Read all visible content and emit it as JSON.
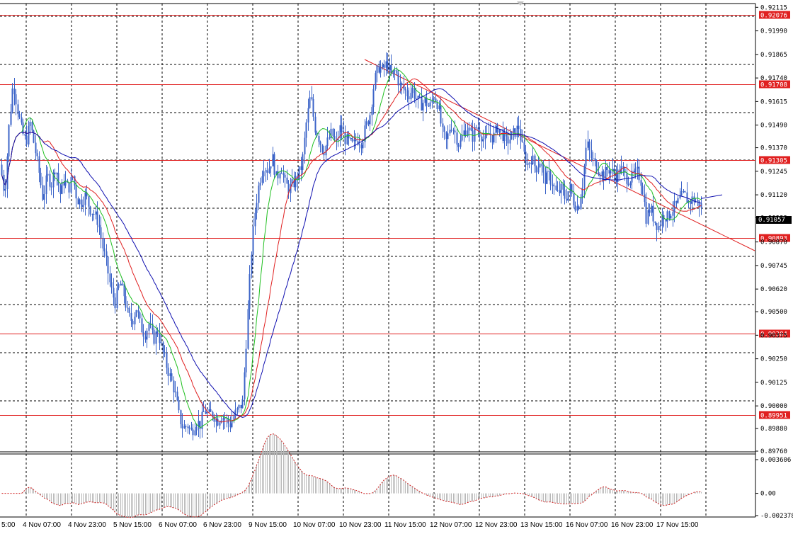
{
  "colors": {
    "background": "#ffffff",
    "grid": "#000000",
    "candles": "#3c64c8",
    "level_lines": "#e02020",
    "trendline": "#e02020",
    "ma_fast": "#20c020",
    "ma_mid": "#e02020",
    "ma_slow": "#1010b0",
    "current_price_tag": "#000000",
    "macd_histogram": "#b8b8b8",
    "macd_signal": "#d02020"
  },
  "chart_data": {
    "type": "candlestick",
    "price_axis_ticks": [
      "0.92115",
      "0.91990",
      "0.91865",
      "0.91740",
      "0.91615",
      "0.91490",
      "0.91370",
      "0.91245",
      "0.91120",
      "0.90999",
      "0.90870",
      "0.90745",
      "0.90620",
      "0.90500",
      "0.90375",
      "0.90250",
      "0.90125",
      "0.90000",
      "0.89880",
      "0.89760"
    ],
    "time_axis_ticks": [
      "5:00",
      "4 Nov 07:00",
      "4 Nov 23:00",
      "5 Nov 15:00",
      "6 Nov 07:00",
      "6 Nov 23:00",
      "9 Nov 15:00",
      "10 Nov 07:00",
      "10 Nov 23:00",
      "11 Nov 15:00",
      "12 Nov 07:00",
      "12 Nov 23:00",
      "13 Nov 15:00",
      "16 Nov 07:00",
      "16 Nov 23:00",
      "17 Nov 15:00"
    ],
    "levels": [
      "0.92076",
      "0.91708",
      "0.91305",
      "0.90893",
      "0.90384",
      "0.89951"
    ],
    "current_price": "0.91057",
    "ylim": [
      0.8976,
      0.92135
    ],
    "close_path": [
      [
        0,
        0.9128
      ],
      [
        6,
        0.9112
      ],
      [
        12,
        0.9148
      ],
      [
        18,
        0.9172
      ],
      [
        24,
        0.9158
      ],
      [
        30,
        0.9146
      ],
      [
        36,
        0.914
      ],
      [
        42,
        0.915
      ],
      [
        48,
        0.9138
      ],
      [
        54,
        0.9125
      ],
      [
        60,
        0.911
      ],
      [
        66,
        0.9122
      ],
      [
        72,
        0.9118
      ],
      [
        78,
        0.9128
      ],
      [
        84,
        0.9112
      ],
      [
        90,
        0.912
      ],
      [
        96,
        0.9115
      ],
      [
        102,
        0.9122
      ],
      [
        108,
        0.911
      ],
      [
        114,
        0.9108
      ],
      [
        120,
        0.9112
      ],
      [
        126,
        0.9105
      ],
      [
        132,
        0.9102
      ],
      [
        138,
        0.9098
      ],
      [
        144,
        0.9085
      ],
      [
        150,
        0.9075
      ],
      [
        156,
        0.9062
      ],
      [
        162,
        0.9055
      ],
      [
        168,
        0.9065
      ],
      [
        174,
        0.906
      ],
      [
        180,
        0.9048
      ],
      [
        186,
        0.9045
      ],
      [
        192,
        0.9052
      ],
      [
        198,
        0.9042
      ],
      [
        204,
        0.9038
      ],
      [
        210,
        0.9044
      ],
      [
        216,
        0.9035
      ],
      [
        222,
        0.904
      ],
      [
        228,
        0.903
      ],
      [
        234,
        0.9022
      ],
      [
        240,
        0.9015
      ],
      [
        246,
        0.9008
      ],
      [
        252,
        0.8995
      ],
      [
        258,
        0.8988
      ],
      [
        264,
        0.899
      ],
      [
        270,
        0.8986
      ],
      [
        276,
        0.8992
      ],
      [
        282,
        0.899
      ],
      [
        288,
        0.8998
      ],
      [
        294,
        0.8995
      ],
      [
        300,
        0.8996
      ],
      [
        306,
        0.8992
      ],
      [
        312,
        0.8995
      ],
      [
        318,
        0.8993
      ],
      [
        324,
        0.899
      ],
      [
        330,
        0.8995
      ],
      [
        336,
        0.8998
      ],
      [
        342,
        0.9002
      ],
      [
        348,
        0.904
      ],
      [
        354,
        0.908
      ],
      [
        360,
        0.9105
      ],
      [
        366,
        0.912
      ],
      [
        372,
        0.9128
      ],
      [
        378,
        0.9125
      ],
      [
        384,
        0.9132
      ],
      [
        390,
        0.912
      ],
      [
        396,
        0.9128
      ],
      [
        402,
        0.9118
      ],
      [
        408,
        0.9115
      ],
      [
        414,
        0.9118
      ],
      [
        420,
        0.9122
      ],
      [
        426,
        0.9128
      ],
      [
        432,
        0.915
      ],
      [
        438,
        0.9165
      ],
      [
        444,
        0.9148
      ],
      [
        450,
        0.9142
      ],
      [
        456,
        0.9135
      ],
      [
        462,
        0.914
      ],
      [
        468,
        0.9145
      ],
      [
        474,
        0.9138
      ],
      [
        480,
        0.9148
      ],
      [
        486,
        0.9142
      ],
      [
        492,
        0.914
      ],
      [
        498,
        0.9138
      ],
      [
        504,
        0.9142
      ],
      [
        510,
        0.914
      ],
      [
        516,
        0.9148
      ],
      [
        522,
        0.9155
      ],
      [
        528,
        0.9172
      ],
      [
        534,
        0.918
      ],
      [
        540,
        0.9178
      ],
      [
        546,
        0.9182
      ],
      [
        552,
        0.9175
      ],
      [
        558,
        0.9178
      ],
      [
        564,
        0.917
      ],
      [
        570,
        0.9168
      ],
      [
        576,
        0.9165
      ],
      [
        582,
        0.9168
      ],
      [
        588,
        0.9162
      ],
      [
        594,
        0.916
      ],
      [
        600,
        0.9162
      ],
      [
        606,
        0.9158
      ],
      [
        612,
        0.9165
      ],
      [
        618,
        0.916
      ],
      [
        624,
        0.9145
      ],
      [
        630,
        0.914
      ],
      [
        636,
        0.915
      ],
      [
        642,
        0.9145
      ],
      [
        648,
        0.9138
      ],
      [
        654,
        0.9145
      ],
      [
        660,
        0.9148
      ],
      [
        666,
        0.9142
      ],
      [
        672,
        0.9148
      ],
      [
        678,
        0.9145
      ],
      [
        684,
        0.914
      ],
      [
        690,
        0.9145
      ],
      [
        696,
        0.9142
      ],
      [
        702,
        0.9148
      ],
      [
        708,
        0.9145
      ],
      [
        714,
        0.914
      ],
      [
        720,
        0.9142
      ],
      [
        726,
        0.9145
      ],
      [
        732,
        0.9148
      ],
      [
        738,
        0.9135
      ],
      [
        744,
        0.9128
      ],
      [
        750,
        0.9132
      ],
      [
        756,
        0.9126
      ],
      [
        762,
        0.913
      ],
      [
        768,
        0.912
      ],
      [
        774,
        0.9122
      ],
      [
        780,
        0.9118
      ],
      [
        786,
        0.9112
      ],
      [
        792,
        0.9115
      ],
      [
        798,
        0.911
      ],
      [
        804,
        0.9116
      ],
      [
        810,
        0.9108
      ],
      [
        816,
        0.9105
      ],
      [
        822,
        0.9118
      ],
      [
        828,
        0.914
      ],
      [
        834,
        0.9132
      ],
      [
        840,
        0.9128
      ],
      [
        846,
        0.9125
      ],
      [
        852,
        0.9122
      ],
      [
        858,
        0.9126
      ],
      [
        864,
        0.9124
      ],
      [
        870,
        0.9122
      ],
      [
        876,
        0.9126
      ],
      [
        882,
        0.9122
      ],
      [
        888,
        0.912
      ],
      [
        894,
        0.9122
      ],
      [
        900,
        0.9124
      ],
      [
        906,
        0.9118
      ],
      [
        912,
        0.91
      ],
      [
        918,
        0.9105
      ],
      [
        924,
        0.9098
      ],
      [
        930,
        0.9095
      ],
      [
        936,
        0.9102
      ],
      [
        942,
        0.91
      ],
      [
        948,
        0.9104
      ],
      [
        954,
        0.9106
      ],
      [
        960,
        0.911
      ],
      [
        966,
        0.9112
      ],
      [
        972,
        0.9108
      ],
      [
        978,
        0.911
      ],
      [
        984,
        0.9108
      ],
      [
        990,
        0.9106
      ]
    ],
    "indicator": {
      "type": "histogram",
      "axis_ticks": [
        "0.003606",
        "0.00",
        "-0.002378"
      ],
      "ylim": [
        -0.002378,
        0.003606
      ]
    }
  }
}
